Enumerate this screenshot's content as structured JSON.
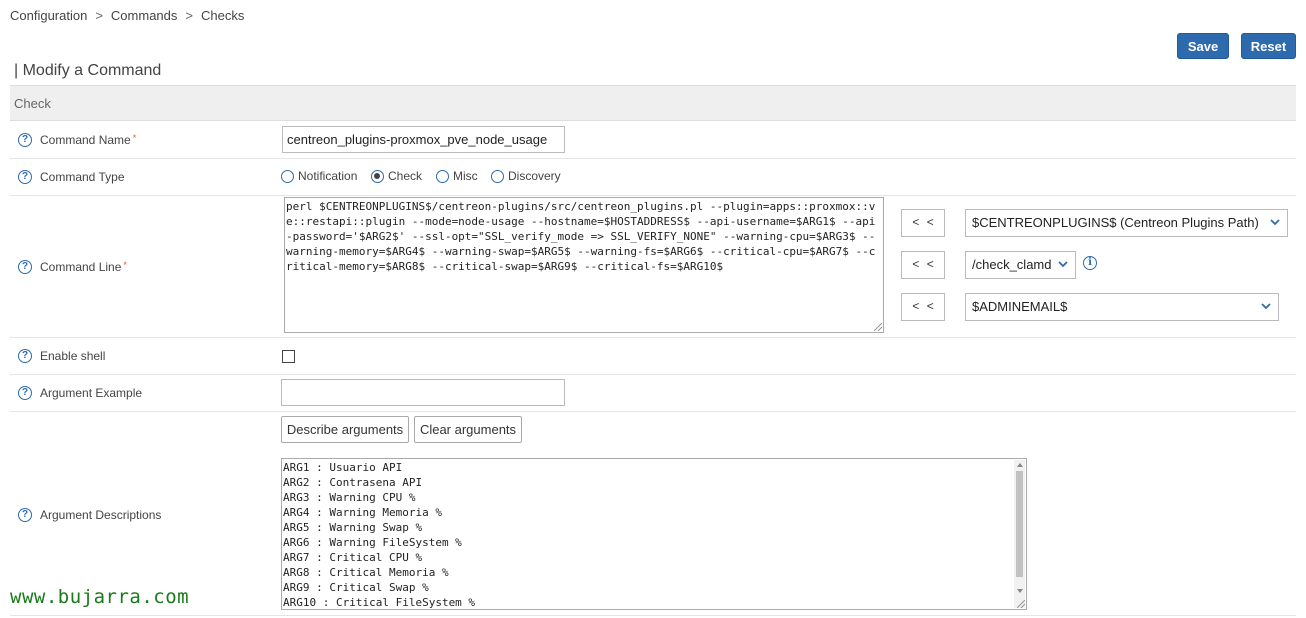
{
  "breadcrumb": {
    "items": [
      "Configuration",
      "Commands",
      "Checks"
    ],
    "separator": ">"
  },
  "toolbar": {
    "save_label": "Save",
    "reset_label": "Reset"
  },
  "page_title": "| Modify a Command",
  "section": {
    "title": "Check"
  },
  "form": {
    "command_name": {
      "label": "Command Name",
      "value": "centreon_plugins-proxmox_pve_node_usage"
    },
    "command_type": {
      "label": "Command Type",
      "options": [
        "Notification",
        "Check",
        "Misc",
        "Discovery"
      ],
      "selected": "Check"
    },
    "command_line": {
      "label": "Command Line",
      "value": "perl $CENTREONPLUGINS$/centreon-plugins/src/centreon_plugins.pl --plugin=apps::proxmox::ve::restapi::plugin --mode=node-usage --hostname=$HOSTADDRESS$ --api-username=$ARG1$ --api-password='$ARG2$' --ssl-opt=\"SSL_verify_mode => SSL_VERIFY_NONE\" --warning-cpu=$ARG3$ --warning-memory=$ARG4$ --warning-swap=$ARG5$ --warning-fs=$ARG6$ --critical-cpu=$ARG7$ --critical-memory=$ARG8$ --critical-swap=$ARG9$ --critical-fs=$ARG10$",
      "insert_label": "< <",
      "macro_select": "$CENTREONPLUGINS$ (Centreon Plugins Path)",
      "plugin_select": "/check_clamd",
      "email_select": "$ADMINEMAIL$"
    },
    "enable_shell": {
      "label": "Enable shell",
      "checked": false
    },
    "argument_example": {
      "label": "Argument Example",
      "value": ""
    },
    "argument_descriptions": {
      "label": "Argument Descriptions",
      "describe_label": "Describe arguments",
      "clear_label": "Clear arguments",
      "lines": [
        "ARG1 : Usuario API",
        "ARG2 : Contrasena API",
        "ARG3 : Warning CPU %",
        "ARG4 : Warning Memoria %",
        "ARG5 : Warning Swap %",
        "ARG6 : Warning FileSystem %",
        "ARG7 : Critical CPU %",
        "ARG8 : Critical Memoria %",
        "ARG9 : Critical Swap %",
        "ARG10 : Critical FileSystem %"
      ]
    }
  },
  "required_marker": "*",
  "watermark": "www.bujarra.com",
  "colors": {
    "accent": "#2e6aae",
    "required": "#d9534f",
    "watermark": "#1a7a1a"
  }
}
